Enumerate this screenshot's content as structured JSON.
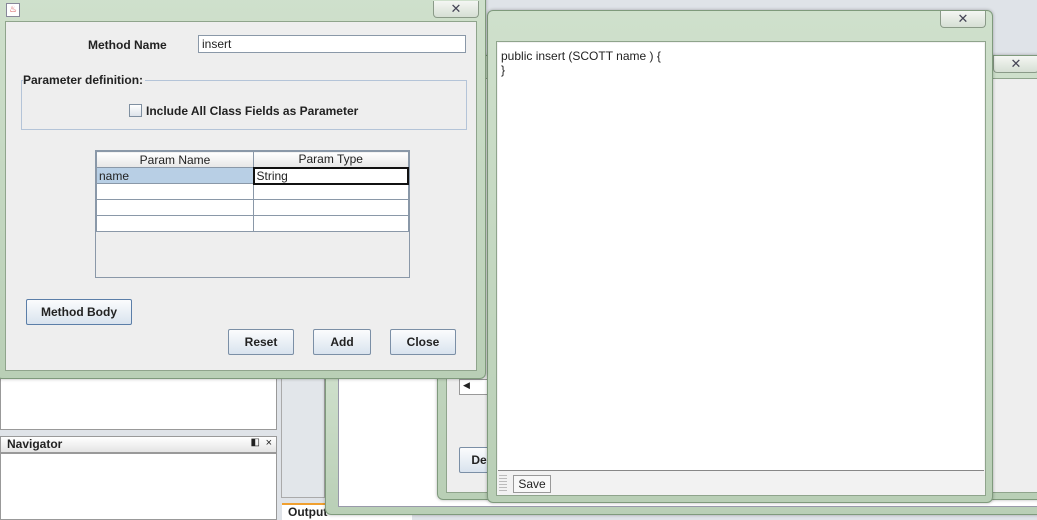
{
  "dialog": {
    "method_name_label": "Method Name",
    "method_name_value": "insert",
    "param_group_label": "Parameter definition:",
    "include_fields_label": "Include All Class Fields as Parameter",
    "include_fields_checked": false,
    "table": {
      "headers": [
        "Param Name",
        "Param Type"
      ],
      "rows": [
        [
          "name",
          "String"
        ],
        [
          "",
          ""
        ],
        [
          "",
          ""
        ],
        [
          "",
          ""
        ]
      ]
    },
    "method_body_button": "Method Body",
    "reset_button": "Reset",
    "add_button": "Add",
    "close_button": "Close"
  },
  "editor": {
    "code_line1": "public insert (SCOTT name ) {",
    "code_line2": "}",
    "save_button": "Save"
  },
  "background": {
    "navigator_title": "Navigator",
    "output_tab": "Output",
    "partial_button": "De"
  },
  "icons": {
    "close": "close-icon",
    "java": "java-icon"
  }
}
